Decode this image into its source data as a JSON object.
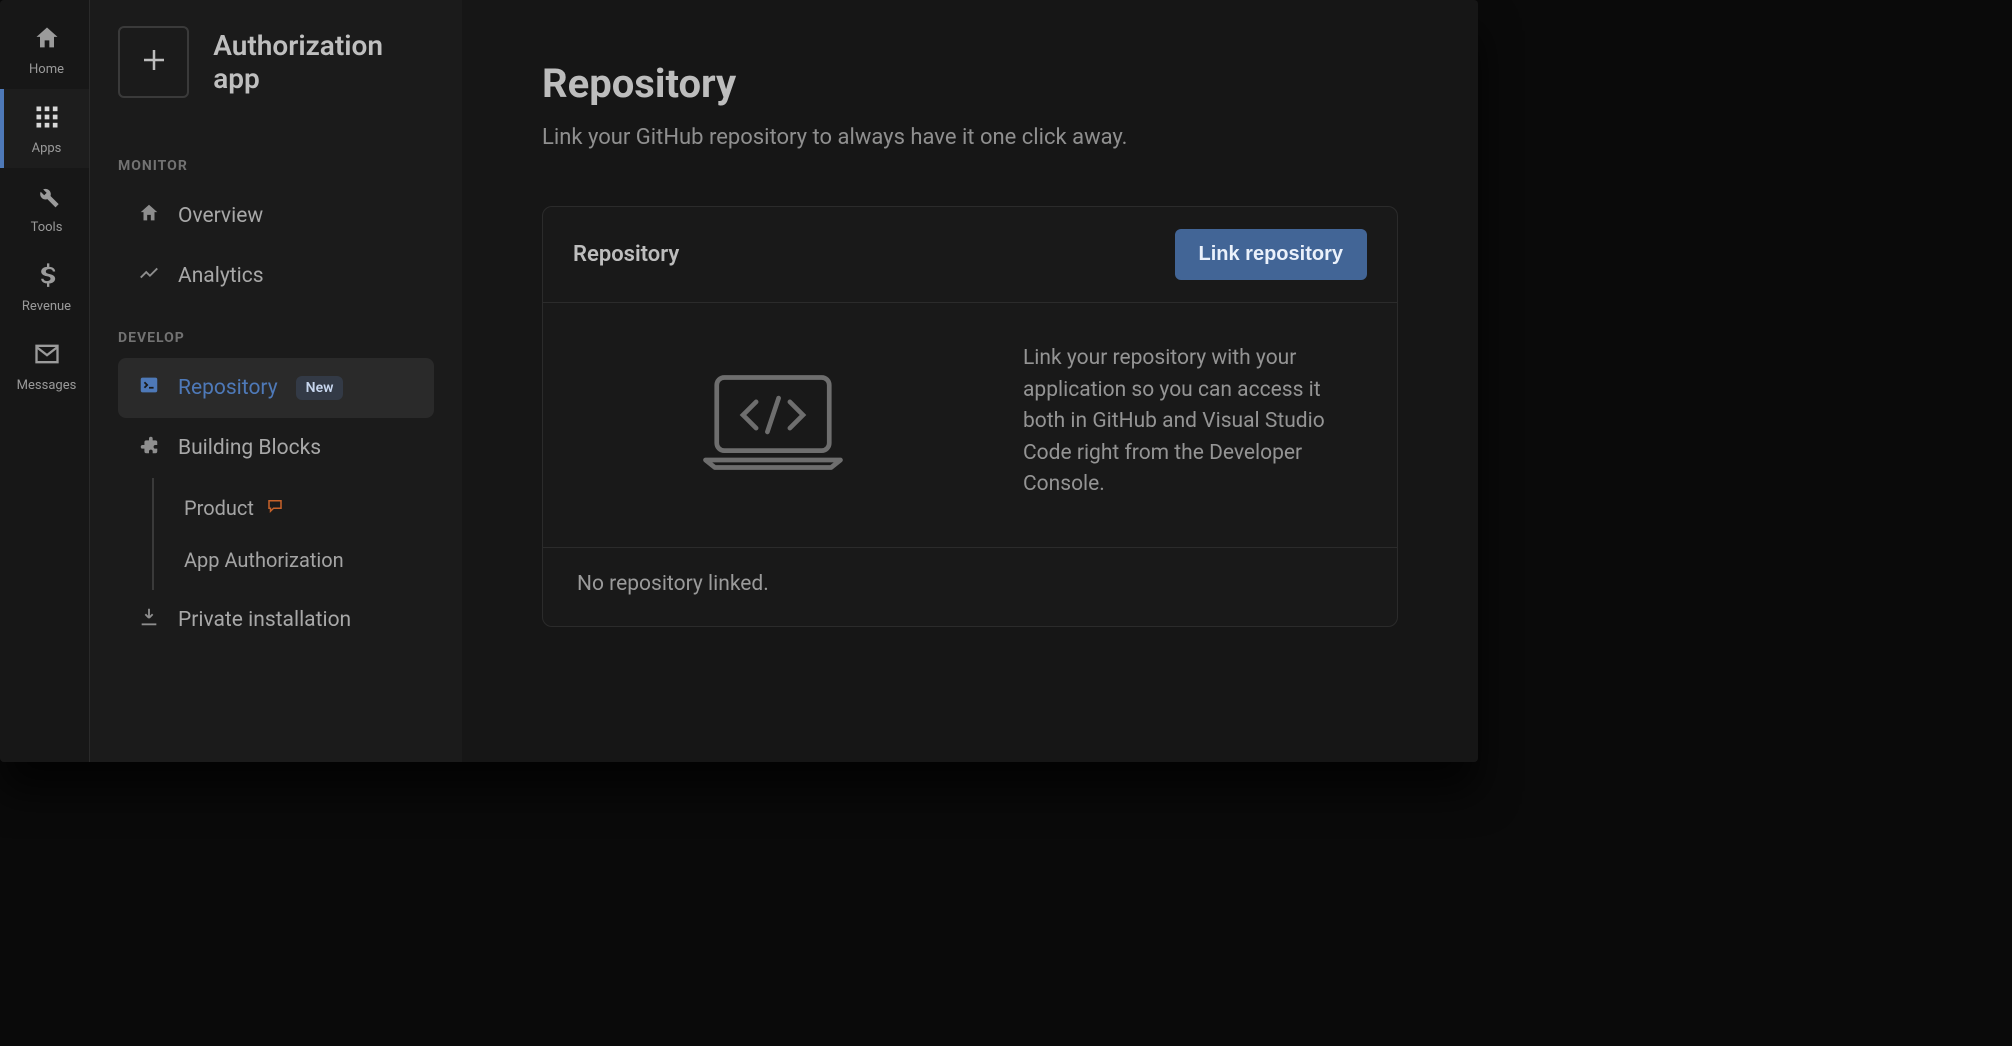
{
  "rail": {
    "home": "Home",
    "apps": "Apps",
    "tools": "Tools",
    "revenue": "Revenue",
    "messages": "Messages"
  },
  "sidebar": {
    "app_name": "Authorization app",
    "sections": {
      "monitor": "MONITOR",
      "develop": "DEVELOP"
    },
    "items": {
      "overview": "Overview",
      "analytics": "Analytics",
      "repository": "Repository",
      "repository_badge": "New",
      "building_blocks": "Building Blocks",
      "product": "Product",
      "app_authorization": "App Authorization",
      "private_installation": "Private installation"
    }
  },
  "main": {
    "title": "Repository",
    "subtitle": "Link your GitHub repository to always have it one click away.",
    "card_title": "Repository",
    "link_button": "Link repository",
    "body_text": "Link your repository with your application so you can access it both in GitHub and Visual Studio Code right from the Developer Console.",
    "footer_text": "No repository linked."
  }
}
